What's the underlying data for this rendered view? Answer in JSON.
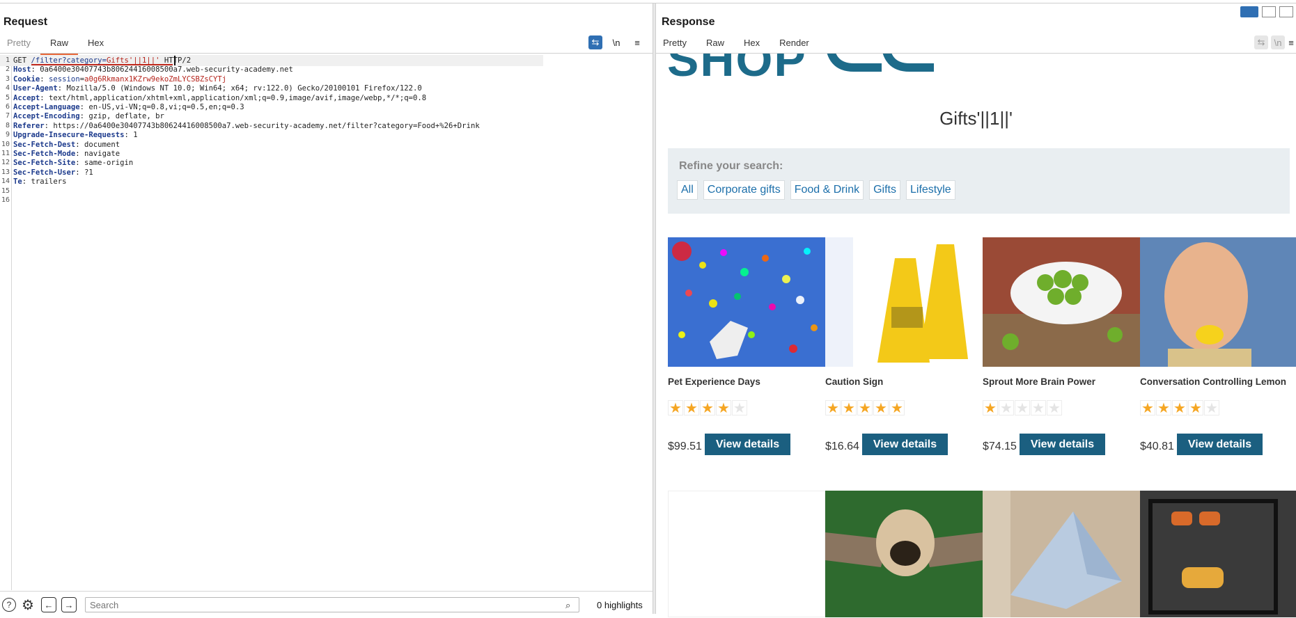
{
  "request": {
    "title": "Request",
    "tabs": [
      "Pretty",
      "Raw",
      "Hex"
    ],
    "tools": {
      "wrap": "⇆",
      "newline": "\\n",
      "menu": "≡"
    },
    "lines": [
      {
        "n": "1",
        "parts": [
          {
            "t": "GET ",
            "c": "val"
          },
          {
            "t": "/filter?category=",
            "c": "blue"
          },
          {
            "t": "Gifts'||1||'",
            "c": "red"
          },
          {
            "t": " HTTP/2",
            "c": "val"
          }
        ]
      },
      {
        "n": "2",
        "parts": [
          {
            "t": "Host",
            "c": "k"
          },
          {
            "t": ": 0a6400e30407743b80624416008500a7.web-security-academy.net",
            "c": "val"
          }
        ]
      },
      {
        "n": "3",
        "parts": [
          {
            "t": "Cookie",
            "c": "k"
          },
          {
            "t": ": ",
            "c": "val"
          },
          {
            "t": "session",
            "c": "blue"
          },
          {
            "t": "=",
            "c": "val"
          },
          {
            "t": "a0g6Rkmanx1KZrw9ekoZmLYCSBZsCYTj",
            "c": "red"
          }
        ]
      },
      {
        "n": "4",
        "parts": [
          {
            "t": "User-Agent",
            "c": "k"
          },
          {
            "t": ": Mozilla/5.0 (Windows NT 10.0; Win64; x64; rv:122.0) Gecko/20100101 Firefox/122.0",
            "c": "val"
          }
        ]
      },
      {
        "n": "5",
        "parts": [
          {
            "t": "Accept",
            "c": "k"
          },
          {
            "t": ": text/html,application/xhtml+xml,application/xml;q=0.9,image/avif,image/webp,*/*;q=0.8",
            "c": "val"
          }
        ]
      },
      {
        "n": "6",
        "parts": [
          {
            "t": "Accept-Language",
            "c": "k"
          },
          {
            "t": ": en-US,vi-VN;q=0.8,vi;q=0.5,en;q=0.3",
            "c": "val"
          }
        ]
      },
      {
        "n": "7",
        "parts": [
          {
            "t": "Accept-Encoding",
            "c": "k"
          },
          {
            "t": ": gzip, deflate, br",
            "c": "val"
          }
        ]
      },
      {
        "n": "8",
        "parts": [
          {
            "t": "Referer",
            "c": "k"
          },
          {
            "t": ": https://0a6400e30407743b80624416008500a7.web-security-academy.net/filter?category=Food+%26+Drink",
            "c": "val"
          }
        ]
      },
      {
        "n": "9",
        "parts": [
          {
            "t": "Upgrade-Insecure-Requests",
            "c": "k"
          },
          {
            "t": ": 1",
            "c": "val"
          }
        ]
      },
      {
        "n": "10",
        "parts": [
          {
            "t": "Sec-Fetch-Dest",
            "c": "k"
          },
          {
            "t": ": document",
            "c": "val"
          }
        ]
      },
      {
        "n": "11",
        "parts": [
          {
            "t": "Sec-Fetch-Mode",
            "c": "k"
          },
          {
            "t": ": navigate",
            "c": "val"
          }
        ]
      },
      {
        "n": "12",
        "parts": [
          {
            "t": "Sec-Fetch-Site",
            "c": "k"
          },
          {
            "t": ": same-origin",
            "c": "val"
          }
        ]
      },
      {
        "n": "13",
        "parts": [
          {
            "t": "Sec-Fetch-User",
            "c": "k"
          },
          {
            "t": ": ?1",
            "c": "val"
          }
        ]
      },
      {
        "n": "14",
        "parts": [
          {
            "t": "Te",
            "c": "k"
          },
          {
            "t": ": trailers",
            "c": "val"
          }
        ]
      },
      {
        "n": "15",
        "parts": []
      },
      {
        "n": "16",
        "parts": []
      }
    ],
    "search_placeholder": "Search",
    "highlights": "0 highlights"
  },
  "response": {
    "title": "Response",
    "tabs": [
      "Pretty",
      "Raw",
      "Hex",
      "Render"
    ],
    "page": {
      "logo": "SHOP",
      "heading": "Gifts'||1||'",
      "refine_label": "Refine your search:",
      "filters": [
        "All",
        "Corporate gifts",
        "Food & Drink",
        "Gifts",
        "Lifestyle"
      ],
      "products": [
        {
          "name": "Pet Experience Days",
          "rating": 4,
          "price": "$99.51",
          "button": "View details"
        },
        {
          "name": "Caution Sign",
          "rating": 5,
          "price": "$16.64",
          "button": "View details"
        },
        {
          "name": "Sprout More Brain Power",
          "rating": 1,
          "price": "$74.15",
          "button": "View details"
        },
        {
          "name": "Conversation Controlling Lemon",
          "rating": 4,
          "price": "$40.81",
          "button": "View details"
        }
      ]
    }
  },
  "colors": {
    "accent_tab": "#e8683a",
    "primary_button": "#1b5f80",
    "link": "#1c6faa",
    "star": "#f5a623"
  }
}
